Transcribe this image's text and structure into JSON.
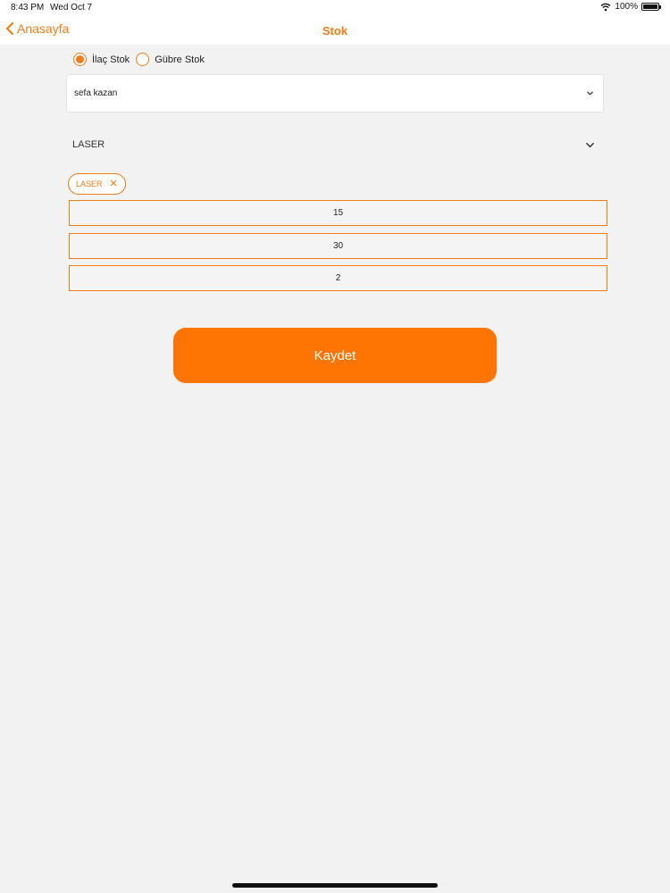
{
  "status_bar": {
    "time": "8:43 PM",
    "date": "Wed Oct 7",
    "battery": "100%",
    "icons": [
      "wifi-icon",
      "battery-icon"
    ]
  },
  "nav": {
    "back_label": "Anasayfa",
    "title": "Stok",
    "accent_color": "#f07c1a"
  },
  "stock_type": {
    "options": [
      {
        "label": "İlaç Stok",
        "selected": true
      },
      {
        "label": "Gübre Stok",
        "selected": false
      }
    ]
  },
  "customer_select": {
    "value": "sefa kazan"
  },
  "product_select": {
    "value": "LASER",
    "selected_chips": [
      "LASER"
    ]
  },
  "quantity_fields": [
    "15",
    "30",
    "2"
  ],
  "save_button": {
    "label": "Kaydet",
    "color": "#ff7504"
  }
}
